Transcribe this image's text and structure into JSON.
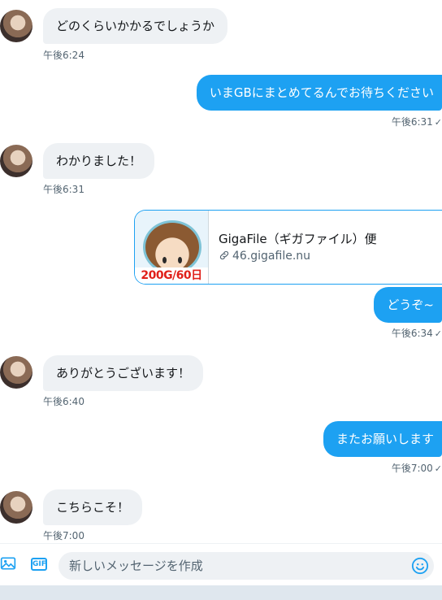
{
  "messages": [
    {
      "dir": "in",
      "text": "どのくらいかかるでしょうか",
      "time": "午後6:24"
    },
    {
      "dir": "out",
      "text": "いまGBにまとめてるんでお待ちください",
      "time": "午後6:31"
    },
    {
      "dir": "in",
      "text": "わかりました！",
      "time": "午後6:31"
    },
    {
      "dir": "out",
      "text": "どうぞ~",
      "time": "午後6:34"
    },
    {
      "dir": "in",
      "text": "ありがとうございます！",
      "time": "午後6:40"
    },
    {
      "dir": "out",
      "text": "またお願いします",
      "time": "午後7:00"
    },
    {
      "dir": "in",
      "text": "こちらこそ！",
      "time": "午後7:00"
    }
  ],
  "link_card": {
    "title": "GigaFile（ギガファイル）便",
    "url": "46.gigafile.nu",
    "thumb_banner": "200G/60日"
  },
  "composer": {
    "placeholder": "新しいメッセージを作成",
    "gif_label": "GIF"
  },
  "colors": {
    "accent": "#1da1f2",
    "incoming_bg": "#eef1f4",
    "muted": "#536471"
  },
  "icons": {
    "read": "check-icon",
    "link": "link-icon",
    "media": "image-icon",
    "emoji": "emoji-icon"
  }
}
